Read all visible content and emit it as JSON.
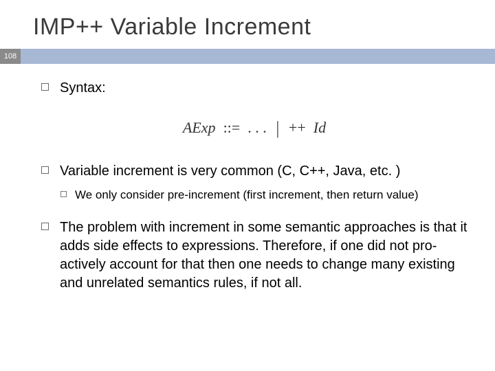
{
  "slide": {
    "title": "IMP++ Variable Increment",
    "number": "108"
  },
  "bullets": {
    "b1": "Syntax:",
    "formula": {
      "lhs": "AExp",
      "def": "::=",
      "dots": ". . .",
      "sep": "|",
      "op": "++",
      "rhs": "Id"
    },
    "b2": "Variable increment is very common (C, C++, Java, etc. )",
    "b2_sub1": "We only consider pre-increment (first increment, then return value)",
    "b3": "The problem with increment in some semantic approaches is that it adds side effects to expressions. Therefore, if one did not pro-actively account for that then one needs to change many existing and unrelated semantics rules, if not all."
  }
}
